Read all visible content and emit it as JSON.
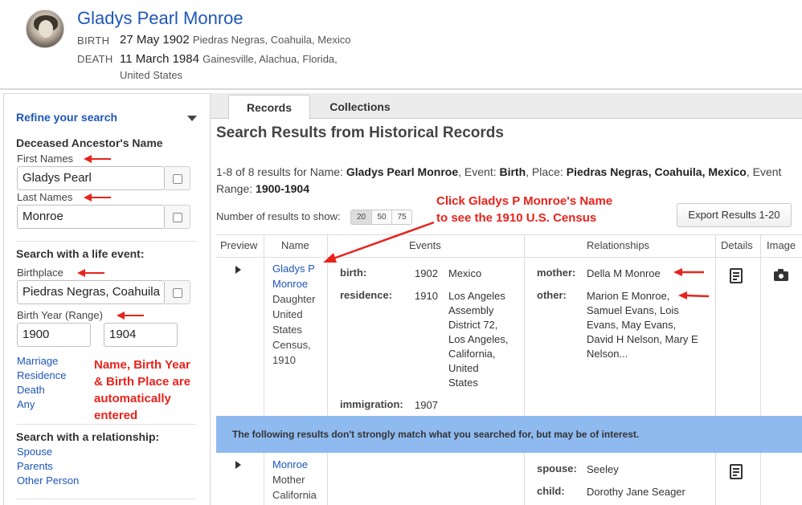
{
  "person": {
    "name": "Gladys Pearl Monroe",
    "birth_label": "BIRTH",
    "birth_date": "27 May 1902",
    "birth_place": "Piedras Negras, Coahuila, Mexico",
    "death_label": "DEATH",
    "death_date": "11 March 1984",
    "death_place_1": "Gainesville, Alachua, Florida,",
    "death_place_2": "United States"
  },
  "sidebar": {
    "title": "Refine your search",
    "ancestor_heading": "Deceased Ancestor's Name",
    "first_names_label": "First Names",
    "first_names_value": "Gladys Pearl",
    "last_names_label": "Last Names",
    "last_names_value": "Monroe",
    "life_event_heading": "Search with a life event:",
    "birthplace_label": "Birthplace",
    "birthplace_value": "Piedras Negras, Coahuila",
    "birth_year_label": "Birth Year (Range)",
    "birth_year_from": "1900",
    "birth_year_to": "1904",
    "event_links": [
      "Marriage",
      "Residence",
      "Death",
      "Any"
    ],
    "relationship_heading": "Search with a relationship:",
    "relationship_links": [
      "Spouse",
      "Parents",
      "Other Person"
    ]
  },
  "annotations": {
    "note_left": [
      "Name, Birth Year",
      "& Birth Place are",
      "automatically",
      "entered"
    ],
    "note_top": [
      "Click Gladys P Monroe's Name",
      "to see the 1910 U.S. Census"
    ],
    "arrow_color": "#e8231c"
  },
  "tabs": [
    "Records",
    "Collections"
  ],
  "results": {
    "title": "Search Results from Historical Records",
    "summary_prefix": "1-8 of 8 results for Name: ",
    "summary_name": "Gladys Pearl Monroe",
    "summary_event_label": ", Event: ",
    "summary_event": "Birth",
    "summary_place_label": ", Place: ",
    "summary_place": "Piedras Negras, Coahuila, Mexico",
    "summary_range_label": ", Event Range: ",
    "summary_range": "1900-1904",
    "show_label": "Number of results to show:",
    "show_options": [
      "20",
      "50",
      "75"
    ],
    "export_button": "Export Results 1-20"
  },
  "table": {
    "headers": [
      "Preview",
      "Name",
      "Events",
      "Relationships",
      "Details",
      "Image"
    ],
    "row1": {
      "name_link_1": "Gladys P",
      "name_link_2": "Monroe",
      "record_lines": [
        "Daughter",
        "United",
        "States",
        "Census,",
        "1910"
      ],
      "events": {
        "birth_label": "birth:",
        "birth_year": "1902",
        "birth_place": "Mexico",
        "residence_label": "residence:",
        "residence_year": "1910",
        "residence_place": [
          "Los Angeles",
          "Assembly",
          "District 72,",
          "Los Angeles,",
          "California,",
          "United",
          "States"
        ],
        "immigration_label": "immigration:",
        "immigration_year": "1907"
      },
      "relationships": {
        "mother_label": "mother:",
        "mother_value": "Della M Monroe",
        "other_label": "other:",
        "other_lines": [
          "Marion E Monroe,",
          "Samuel Evans, Lois",
          "Evans, May Evans,",
          "David H Nelson, Mary E",
          "Nelson..."
        ]
      }
    },
    "banner": "The following results don't strongly match what you searched for, but may be of interest.",
    "row2": {
      "name_link": "Monroe",
      "record_lines": [
        "Mother",
        "California"
      ],
      "relationships": {
        "spouse_label": "spouse:",
        "spouse_value": "Seeley",
        "child_label": "child:",
        "child_value": "Dorothy Jane Seager"
      }
    }
  }
}
